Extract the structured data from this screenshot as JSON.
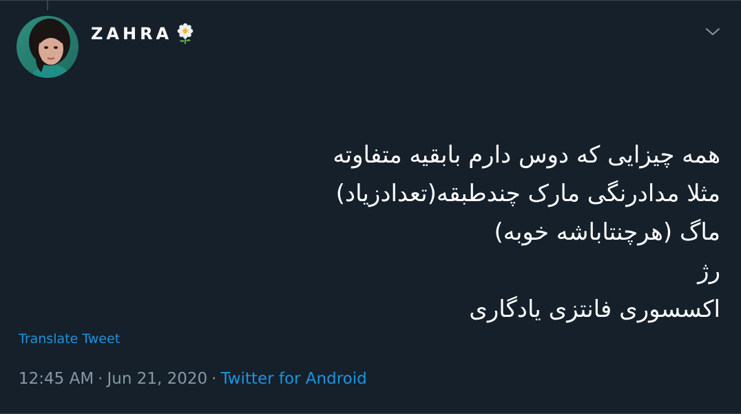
{
  "tweet": {
    "author": {
      "name": "ZAHRA",
      "emoji_icon": "white-flower-icon",
      "avatar_icon": "user-avatar"
    },
    "menu_icon": "chevron-down-icon",
    "lines": [
      "همه چیزایی که دوس دارم بابقیه متفاوته",
      "مثلا مدادرنگی مارک چندطبقه(تعدادزیاد)",
      "ماگ (هرچنتاباشه خوبه)",
      "رژ",
      "اکسسوری فانتزی یادگاری"
    ],
    "translate_label": "Translate Tweet",
    "time": "12:45 AM",
    "date": "Jun 21, 2020",
    "separator": "·",
    "source": "Twitter for Android"
  },
  "colors": {
    "background": "#15202b",
    "text": "#ffffff",
    "muted": "#8899a6",
    "link": "#1b95e0",
    "border": "#38444d"
  }
}
